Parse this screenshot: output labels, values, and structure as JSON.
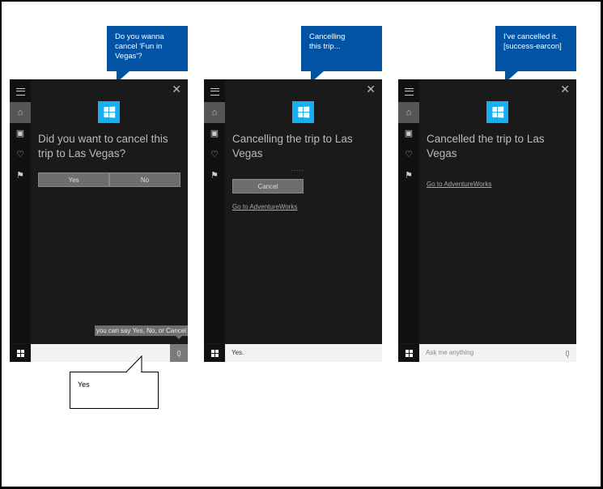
{
  "bubbles": [
    {
      "text_line1": "Do you wanna",
      "text_line2": "cancel 'Fun in",
      "text_line3": "Vegas'?"
    },
    {
      "text_line1": "Cancelling",
      "text_line2": "this trip...",
      "text_line3": ""
    },
    {
      "text_line1": "I've cancelled it.",
      "text_line2": "[success-earcon]",
      "text_line3": ""
    }
  ],
  "panels": [
    {
      "heading": "Did you want to cancel this trip to Las Vegas?",
      "buttons": {
        "yes": "Yes",
        "no": "No"
      },
      "hint": "you can say Yes, No, or Cancel",
      "search_value": ""
    },
    {
      "heading": "Cancelling the trip to Las Vegas",
      "progress_dots": ".....",
      "cancel_button": "Cancel",
      "link": "Go to AdventureWorks",
      "search_value": "Yes."
    },
    {
      "heading": "Cancelled the trip to Las Vegas",
      "link": "Go to AdventureWorks",
      "search_placeholder": "Ask me anything"
    }
  ],
  "sidebar_icons": [
    "hamburger-icon",
    "home-icon",
    "notebook-icon",
    "lightbulb-icon",
    "feedback-icon"
  ],
  "callout": {
    "text": "Yes"
  },
  "colors": {
    "bubble": "#0353a4",
    "panel": "#1a1a1a",
    "logo": "#14b0ef",
    "button": "#6e6e6e"
  }
}
